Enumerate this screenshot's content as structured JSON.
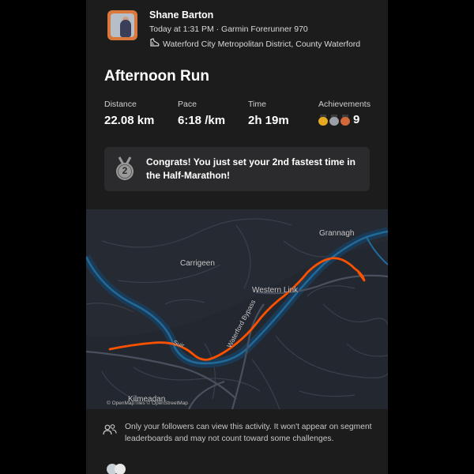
{
  "header": {
    "athlete_name": "Shane Barton",
    "meta": "Today at 1:31 PM · Garmin Forerunner 970",
    "location": "Waterford City Metropolitan District, County Waterford"
  },
  "activity": {
    "title": "Afternoon Run",
    "stats": [
      {
        "label": "Distance",
        "value": "22.08 km"
      },
      {
        "label": "Pace",
        "value": "6:18 /km"
      },
      {
        "label": "Time",
        "value": "2h 19m"
      }
    ],
    "achievements": {
      "label": "Achievements",
      "count": "9",
      "medals": [
        "gold",
        "silver",
        "bronze"
      ]
    }
  },
  "congrats": {
    "badge_number": "2",
    "text": "Congrats! You just set your 2nd fastest time in the Half-Marathon!"
  },
  "map": {
    "labels": {
      "grannagh": "Grannagh",
      "carrigeen": "Carrigeen",
      "western_link": "Western Link",
      "suir": "Suir",
      "bypass": "Waterford Bypass",
      "kilmeadan": "Kilmeadan"
    },
    "attribution": "© OpenMapTiles © OpenStreetMap",
    "route_color": "#fc5200",
    "river_color": "#1f6b9c"
  },
  "privacy": {
    "text": "Only your followers can view this activity. It won't appear on segment leaderboards and may not count toward some challenges."
  }
}
